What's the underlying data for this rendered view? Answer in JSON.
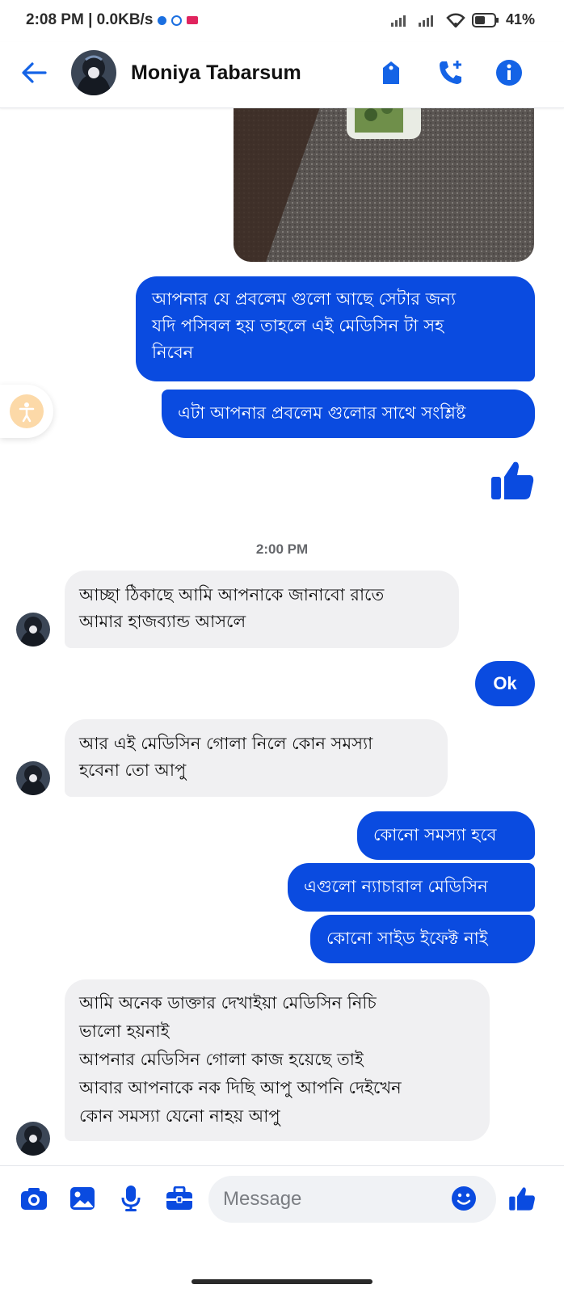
{
  "status_bar": {
    "time_and_speed": "2:08 PM | 0.0KB/s",
    "battery": "41%"
  },
  "header": {
    "contact_name": "Moniya Tabarsum"
  },
  "messages": {
    "out_1": "আপনার যে প্রবলেম গুলো আছে সেটার জন্য\nযদি পসিবল হয় তাহলে এই মেডিসিন টা সহ\nনিবেন",
    "out_2": "এটা আপনার প্রবলেম গুলোর সাথে সংশ্লিষ্ট",
    "timestamp": "2:00 PM",
    "in_1": "আচ্ছা ঠিকাছে আমি আপনাকে জানাবো রাতে\nআমার হাজব্যান্ড আসলে",
    "out_3": "Ok",
    "in_2": "আর এই মেডিসিন গোলা নিলে  কোন সমস্যা\nহবেনা তো আপু",
    "out_4": "কোনো সমস্যা হবে",
    "out_5": "এগুলো ন্যাচারাল মেডিসিন",
    "out_6": "কোনো সাইড ইফেক্ট নাই",
    "in_3": "আমি অনেক ডাক্তার দেখাইয়া মেডিসিন নিচি\nভালো হয়নাই\nআপনার মেডিসিন গোলা কাজ হয়েছে তাই\nআবার আপনাকে নক দিছি আপু আপনি দেইখেন\nকোন সমস্যা যেনো নাহয় আপু"
  },
  "composer": {
    "placeholder": "Message"
  },
  "icons": {
    "back": "arrow-left-icon",
    "tag": "tag-icon",
    "call": "phone-plus-icon",
    "info": "info-icon",
    "like": "thumbs-up-icon",
    "camera": "camera-icon",
    "gallery": "image-icon",
    "mic": "microphone-icon",
    "toolbox": "briefcase-icon",
    "emoji": "smiley-icon",
    "accessibility": "accessibility-icon"
  },
  "colors": {
    "accent": "#0a4be0",
    "incoming_bubble": "#f0f0f2"
  }
}
